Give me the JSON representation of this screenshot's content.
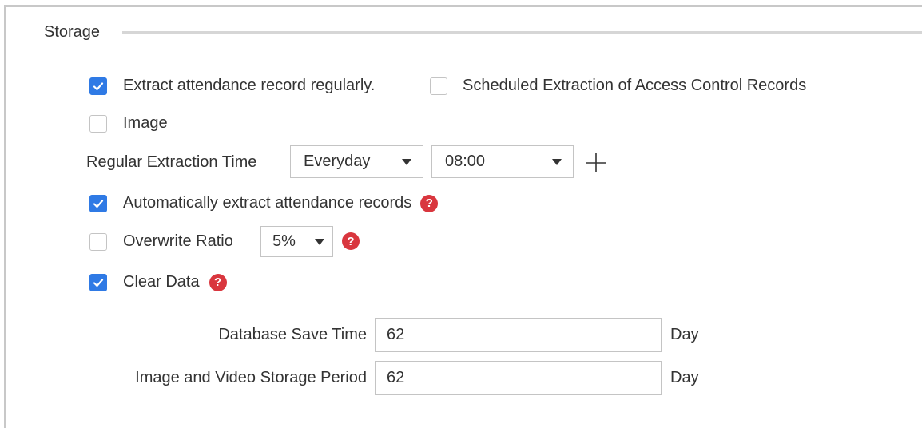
{
  "section": {
    "title": "Storage"
  },
  "options": {
    "extract_regularly": {
      "label": "Extract attendance record regularly.",
      "checked": true
    },
    "scheduled_access": {
      "label": "Scheduled Extraction of Access Control Records",
      "checked": false
    },
    "image": {
      "label": "Image",
      "checked": false
    },
    "auto_extract": {
      "label": "Automatically extract attendance records",
      "checked": true
    },
    "overwrite": {
      "label": "Overwrite Ratio",
      "checked": false
    },
    "clear_data": {
      "label": "Clear Data",
      "checked": true
    }
  },
  "extraction_time": {
    "label": "Regular Extraction Time",
    "frequency": "Everyday",
    "time": "08:00"
  },
  "overwrite_ratio": {
    "value": "5%"
  },
  "help_glyph": "?",
  "database_save_time": {
    "label": "Database Save Time",
    "value": "62",
    "unit": "Day"
  },
  "storage_period": {
    "label": "Image and Video Storage Period",
    "value": "62",
    "unit": "Day"
  },
  "colors": {
    "accent": "#2f7ae5",
    "help": "#d9363e",
    "border": "#c4c4c4"
  },
  "icons": {
    "checkbox_checked": "check-icon",
    "add": "plus-icon",
    "help": "help-icon",
    "dropdown": "caret-down-icon"
  }
}
